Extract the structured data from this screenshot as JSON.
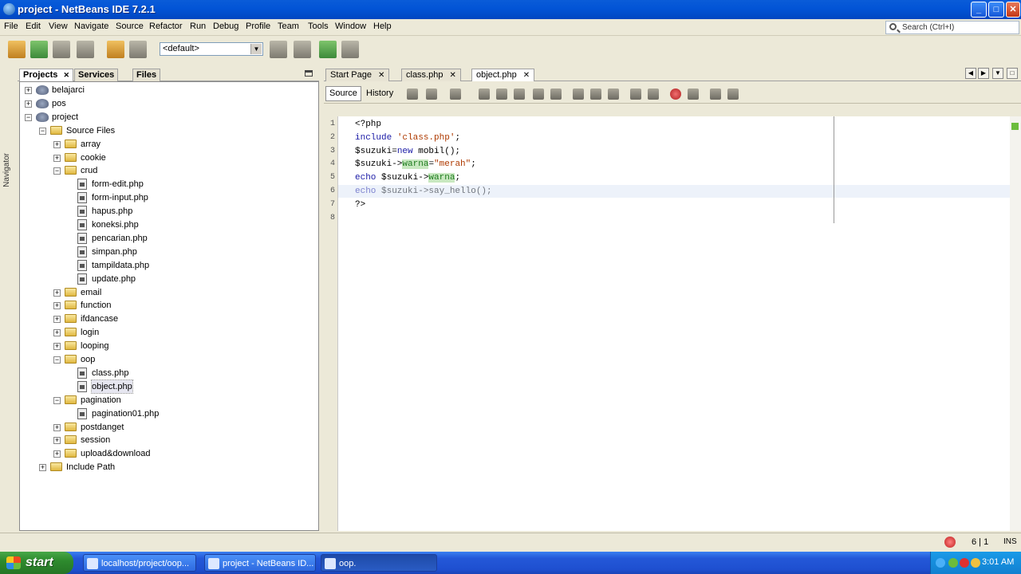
{
  "window": {
    "title": "project - NetBeans IDE 7.2.1"
  },
  "menu": [
    "File",
    "Edit",
    "View",
    "Navigate",
    "Source",
    "Refactor",
    "Run",
    "Debug",
    "Profile",
    "Team",
    "Tools",
    "Window",
    "Help"
  ],
  "search": {
    "placeholder": "Search (Ctrl+I)"
  },
  "toolbar": {
    "config_value": "<default>"
  },
  "navigator": {
    "label": "Navigator"
  },
  "panel_tabs": [
    "Projects",
    "Services",
    "Files"
  ],
  "tree": [
    {
      "label": "belajarci",
      "level": 0,
      "type": "project",
      "expanded": false
    },
    {
      "label": "pos",
      "level": 0,
      "type": "project",
      "expanded": false
    },
    {
      "label": "project",
      "level": 0,
      "type": "project",
      "expanded": true
    },
    {
      "label": "Source Files",
      "level": 1,
      "type": "folder",
      "expanded": true
    },
    {
      "label": "array",
      "level": 2,
      "type": "folder",
      "expanded": false
    },
    {
      "label": "cookie",
      "level": 2,
      "type": "folder",
      "expanded": false
    },
    {
      "label": "crud",
      "level": 2,
      "type": "folder",
      "expanded": true
    },
    {
      "label": "form-edit.php",
      "level": 3,
      "type": "file"
    },
    {
      "label": "form-input.php",
      "level": 3,
      "type": "file"
    },
    {
      "label": "hapus.php",
      "level": 3,
      "type": "file"
    },
    {
      "label": "koneksi.php",
      "level": 3,
      "type": "file"
    },
    {
      "label": "pencarian.php",
      "level": 3,
      "type": "file"
    },
    {
      "label": "simpan.php",
      "level": 3,
      "type": "file"
    },
    {
      "label": "tampildata.php",
      "level": 3,
      "type": "file"
    },
    {
      "label": "update.php",
      "level": 3,
      "type": "file"
    },
    {
      "label": "email",
      "level": 2,
      "type": "folder",
      "expanded": false
    },
    {
      "label": "function",
      "level": 2,
      "type": "folder",
      "expanded": false
    },
    {
      "label": "ifdancase",
      "level": 2,
      "type": "folder",
      "expanded": false
    },
    {
      "label": "login",
      "level": 2,
      "type": "folder",
      "expanded": false
    },
    {
      "label": "looping",
      "level": 2,
      "type": "folder",
      "expanded": false
    },
    {
      "label": "oop",
      "level": 2,
      "type": "folder",
      "expanded": true
    },
    {
      "label": "class.php",
      "level": 3,
      "type": "file"
    },
    {
      "label": "object.php",
      "level": 3,
      "type": "file",
      "selected": true
    },
    {
      "label": "pagination",
      "level": 2,
      "type": "folder",
      "expanded": true
    },
    {
      "label": "pagination01.php",
      "level": 3,
      "type": "file"
    },
    {
      "label": "postdanget",
      "level": 2,
      "type": "folder",
      "expanded": false
    },
    {
      "label": "session",
      "level": 2,
      "type": "folder",
      "expanded": false
    },
    {
      "label": "upload&download",
      "level": 2,
      "type": "folder",
      "expanded": false
    },
    {
      "label": "Include Path",
      "level": 1,
      "type": "folder",
      "expanded": false
    }
  ],
  "editor_tabs": [
    {
      "label": "Start Page",
      "active": false
    },
    {
      "label": "class.php",
      "active": false
    },
    {
      "label": "object.php",
      "active": true
    }
  ],
  "editor_modes": [
    "Source",
    "History"
  ],
  "code": [
    [
      [
        "plain",
        "<?php"
      ]
    ],
    [
      [
        "kw",
        "include "
      ],
      [
        "str",
        "'class.php'"
      ],
      [
        "plain",
        ";"
      ]
    ],
    [
      [
        "plain",
        "$suzuki="
      ],
      [
        "kw",
        "new"
      ],
      [
        "plain",
        " mobil();"
      ]
    ],
    [
      [
        "plain",
        "$suzuki->"
      ],
      [
        "fld",
        "warna"
      ],
      [
        "plain",
        "="
      ],
      [
        "str",
        "\"merah\""
      ],
      [
        "plain",
        ";"
      ]
    ],
    [
      [
        "kw",
        "echo"
      ],
      [
        "plain",
        " $suzuki->"
      ],
      [
        "fld",
        "warna"
      ],
      [
        "plain",
        ";"
      ]
    ],
    [
      [
        "kw",
        "echo"
      ],
      [
        "plain",
        " $suzuki->say_hello();"
      ]
    ],
    [
      [
        "plain",
        "?>"
      ]
    ],
    [
      [
        "plain",
        ""
      ]
    ]
  ],
  "line_numbers": [
    "1",
    "2",
    "3",
    "4",
    "5",
    "6",
    "7",
    "8"
  ],
  "status": {
    "position": "6 | 1",
    "mode": "INS"
  },
  "taskbar": {
    "start": "start",
    "tasks": [
      {
        "label": "localhost/project/oop...",
        "active": false
      },
      {
        "label": "project - NetBeans ID...",
        "active": false
      },
      {
        "label": "oop.",
        "active": true
      }
    ],
    "clock": "3:01 AM"
  }
}
